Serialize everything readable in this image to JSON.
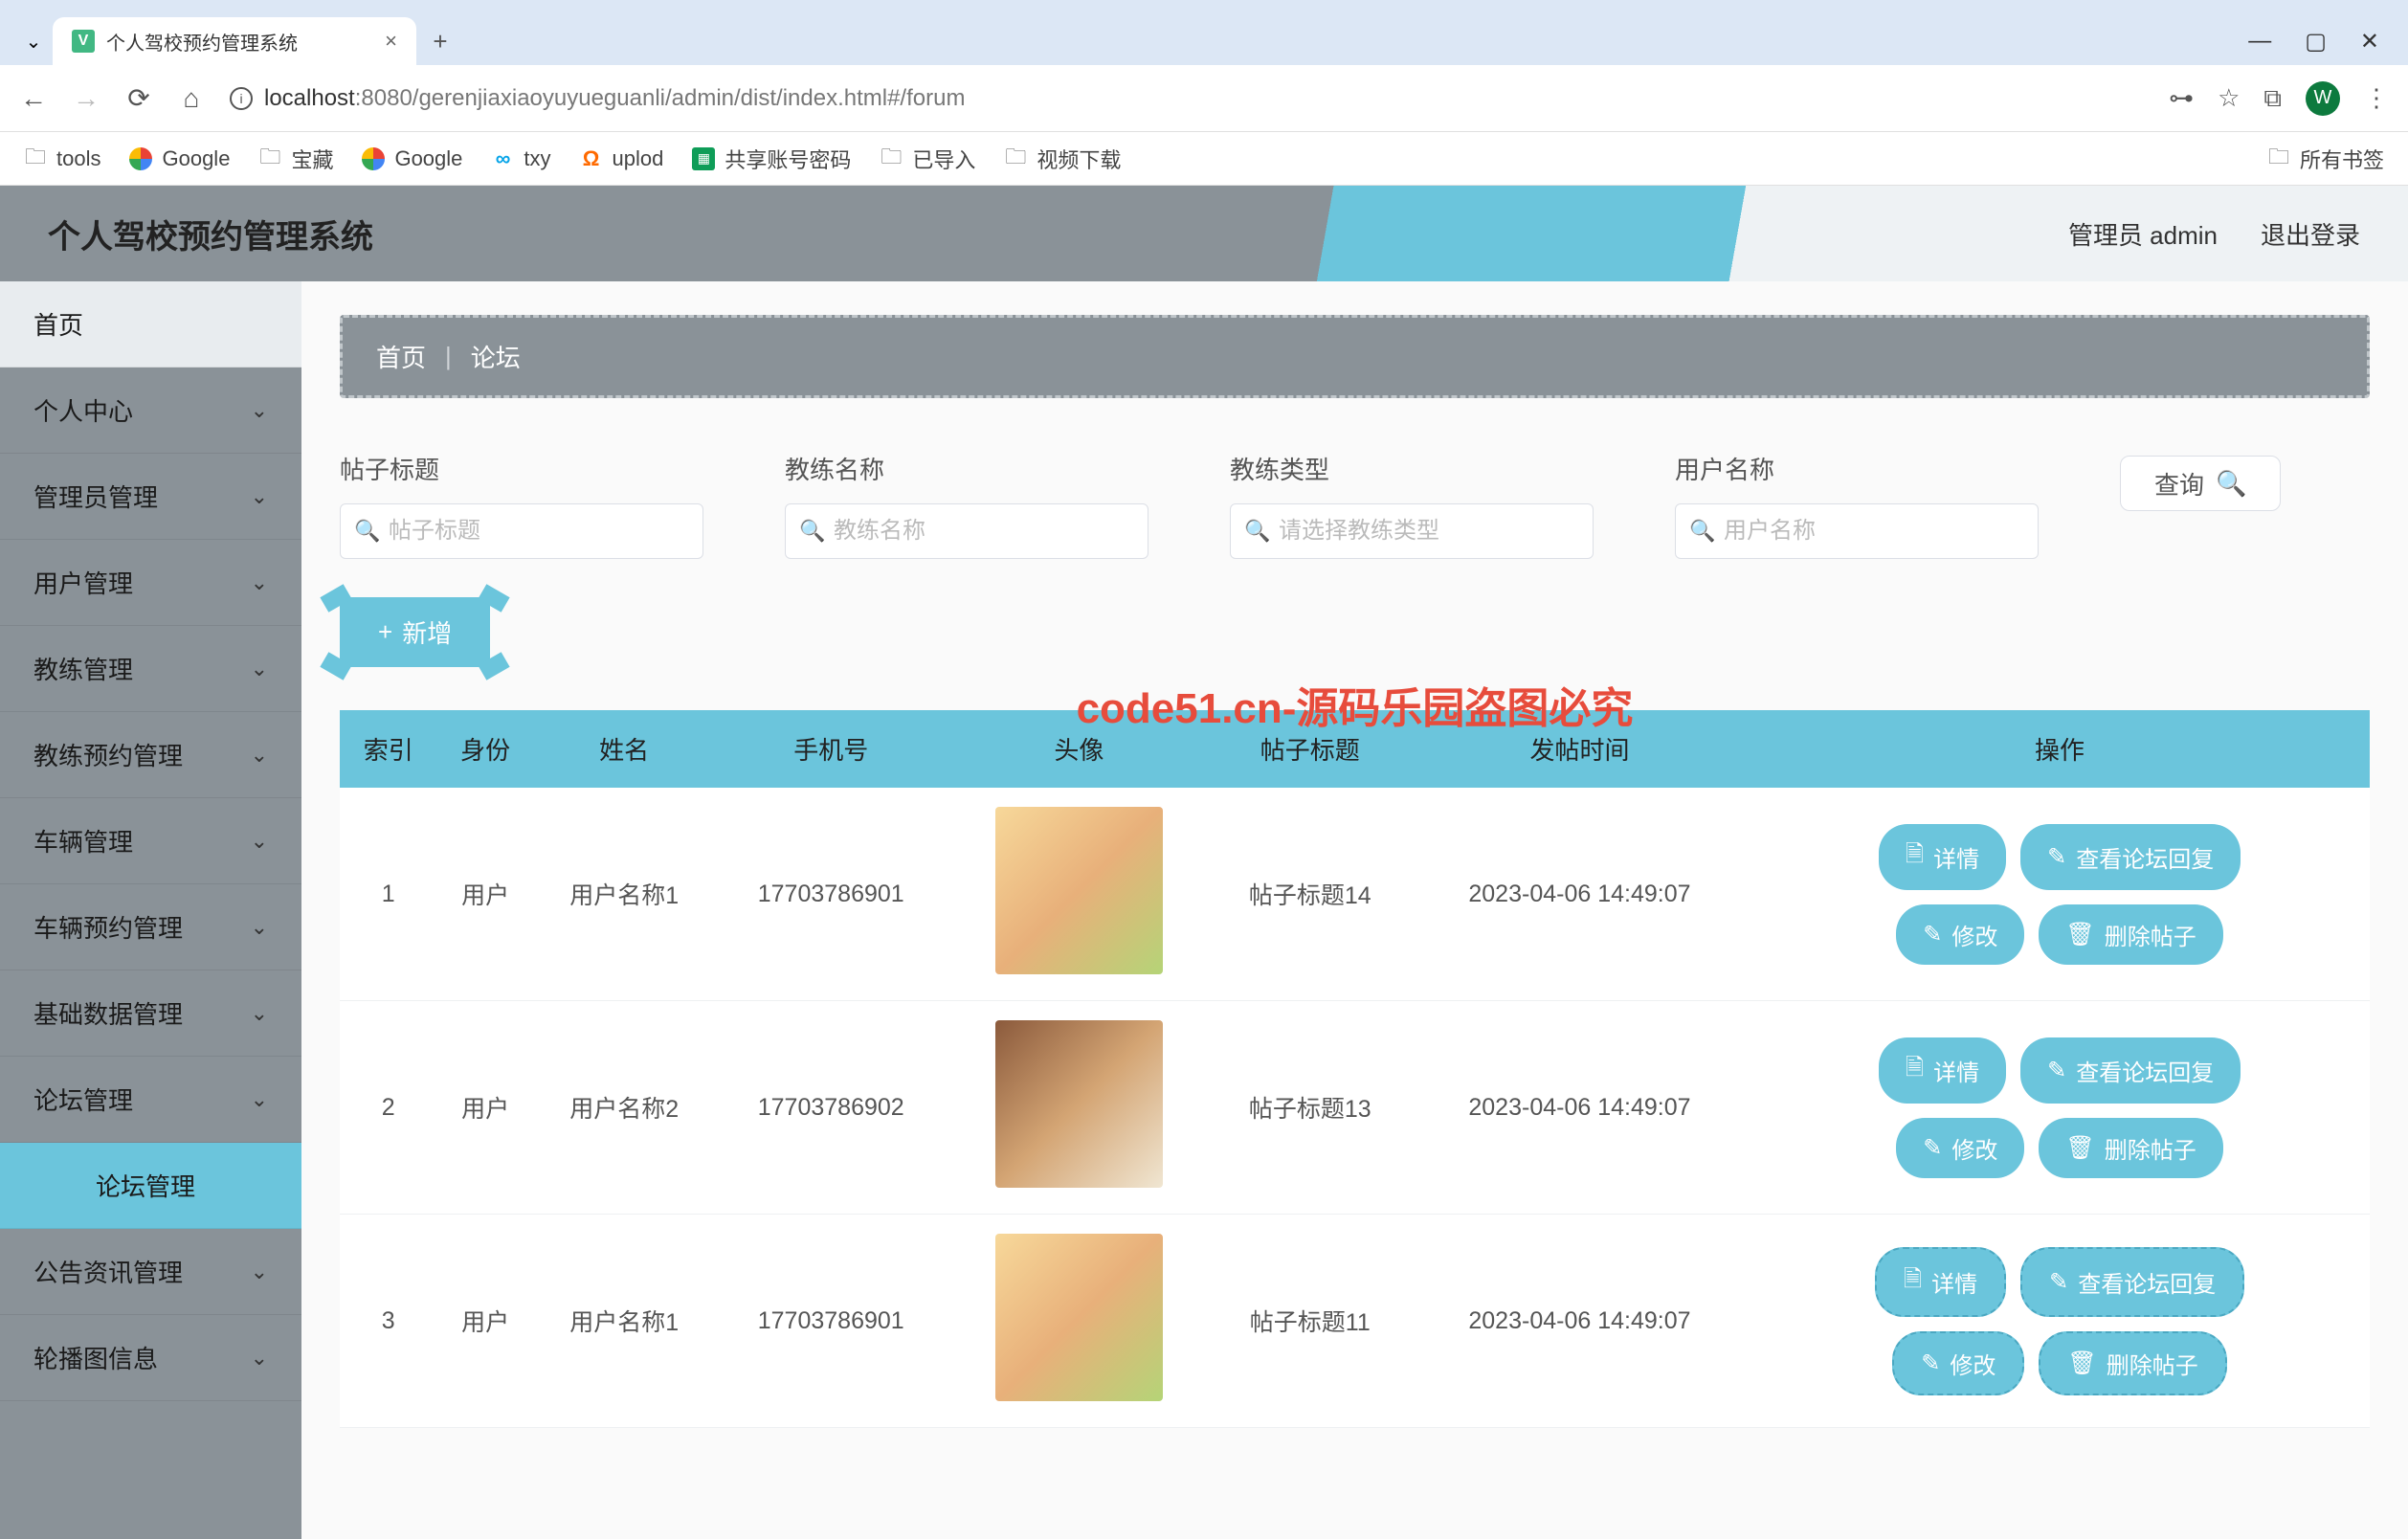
{
  "browser": {
    "tab_title": "个人驾校预约管理系统",
    "url_host": "localhost",
    "url_port_path": ":8080/gerenjiaxiaoyuyueguanli/admin/dist/index.html#/forum",
    "bookmarks": [
      "tools",
      "Google",
      "宝藏",
      "Google",
      "txy",
      "uplod",
      "共享账号密码",
      "已导入",
      "视频下载"
    ],
    "all_bookmarks": "所有书签",
    "avatar_letter": "W"
  },
  "header": {
    "app_title": "个人驾校预约管理系统",
    "admin_label": "管理员 admin",
    "logout": "退出登录"
  },
  "sidebar": {
    "items": [
      {
        "label": "首页",
        "expandable": false,
        "top": true
      },
      {
        "label": "个人中心",
        "expandable": true
      },
      {
        "label": "管理员管理",
        "expandable": true
      },
      {
        "label": "用户管理",
        "expandable": true
      },
      {
        "label": "教练管理",
        "expandable": true
      },
      {
        "label": "教练预约管理",
        "expandable": true
      },
      {
        "label": "车辆管理",
        "expandable": true
      },
      {
        "label": "车辆预约管理",
        "expandable": true
      },
      {
        "label": "基础数据管理",
        "expandable": true
      },
      {
        "label": "论坛管理",
        "expandable": true,
        "expanded": true,
        "sub": "论坛管理"
      },
      {
        "label": "公告资讯管理",
        "expandable": true
      },
      {
        "label": "轮播图信息",
        "expandable": true
      }
    ]
  },
  "breadcrumb": {
    "home": "首页",
    "current": "论坛"
  },
  "search": {
    "fields": [
      {
        "label": "帖子标题",
        "placeholder": "帖子标题"
      },
      {
        "label": "教练名称",
        "placeholder": "教练名称"
      },
      {
        "label": "教练类型",
        "placeholder": "请选择教练类型"
      },
      {
        "label": "用户名称",
        "placeholder": "用户名称"
      }
    ],
    "query_btn": "查询"
  },
  "add_btn": "新增",
  "table": {
    "headers": [
      "索引",
      "身份",
      "姓名",
      "手机号",
      "头像",
      "帖子标题",
      "发帖时间",
      "操作"
    ],
    "rows": [
      {
        "index": "1",
        "role": "用户",
        "name": "用户名称1",
        "phone": "17703786901",
        "title": "帖子标题14",
        "time": "2023-04-06 14:49:07",
        "avatar": 1
      },
      {
        "index": "2",
        "role": "用户",
        "name": "用户名称2",
        "phone": "17703786902",
        "title": "帖子标题13",
        "time": "2023-04-06 14:49:07",
        "avatar": 2
      },
      {
        "index": "3",
        "role": "用户",
        "name": "用户名称1",
        "phone": "17703786901",
        "title": "帖子标题11",
        "time": "2023-04-06 14:49:07",
        "avatar": 1
      }
    ],
    "actions": {
      "detail": "详情",
      "view_reply": "查看论坛回复",
      "edit": "修改",
      "delete": "删除帖子"
    }
  },
  "watermark": "code51.cn-源码乐园盗图必究"
}
